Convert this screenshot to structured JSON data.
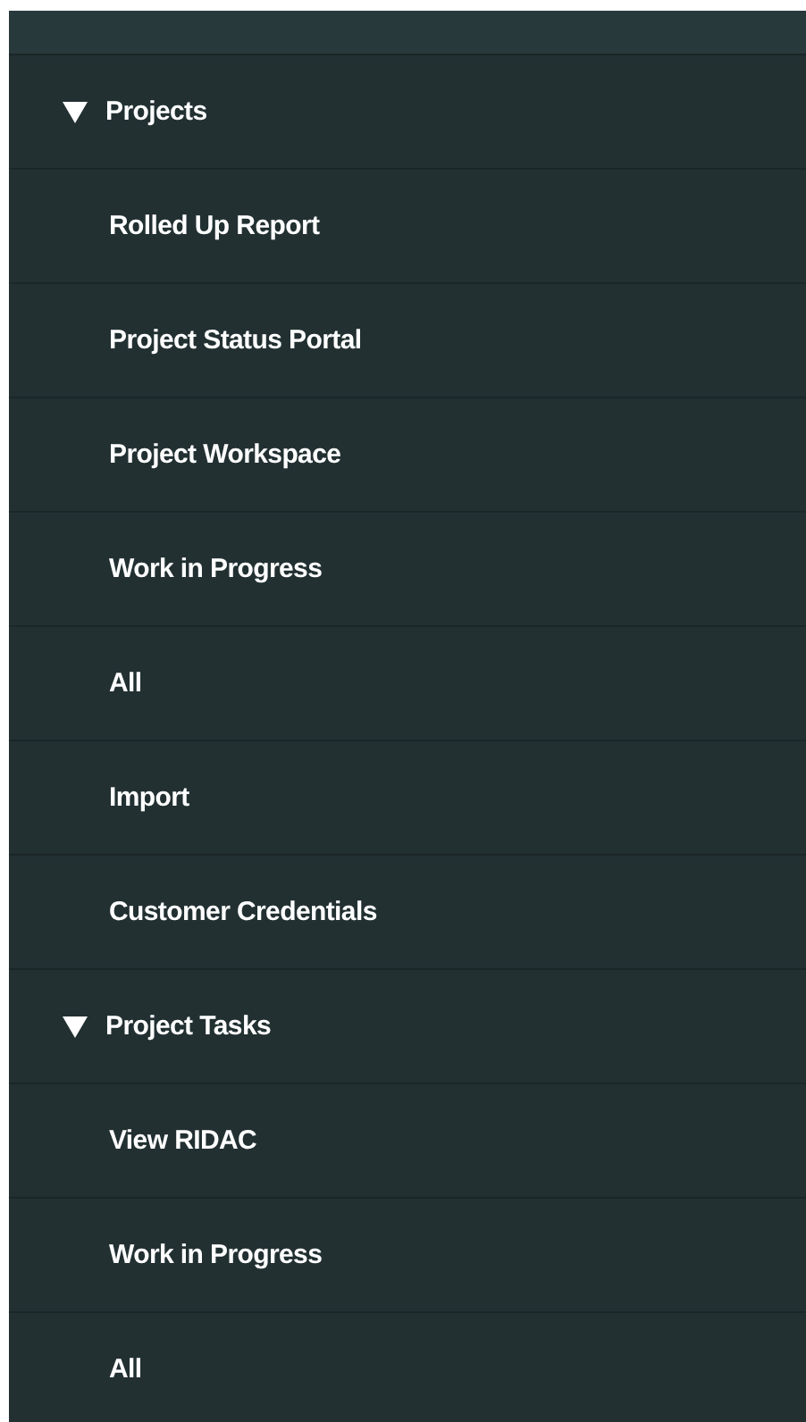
{
  "sections": [
    {
      "label": "Projects",
      "expanded": true,
      "items": [
        {
          "label": "Rolled Up Report"
        },
        {
          "label": "Project Status Portal"
        },
        {
          "label": "Project Workspace"
        },
        {
          "label": "Work in Progress"
        },
        {
          "label": "All"
        },
        {
          "label": "Import"
        },
        {
          "label": "Customer Credentials"
        }
      ]
    },
    {
      "label": "Project Tasks",
      "expanded": true,
      "items": [
        {
          "label": "View RIDAC"
        },
        {
          "label": "Work in Progress"
        },
        {
          "label": "All"
        }
      ]
    }
  ]
}
